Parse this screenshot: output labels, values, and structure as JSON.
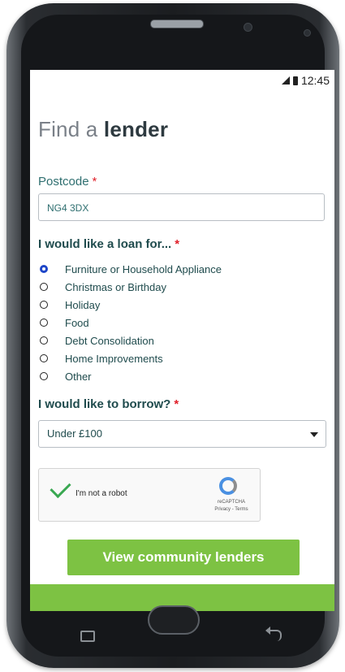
{
  "status": {
    "time": "12:45"
  },
  "form": {
    "title_light": "Find a",
    "title_bold": "lender",
    "postcode_label": "Postcode",
    "postcode_value": "NG4 3DX",
    "required_mark": "*",
    "loan_question": "I would like a loan for...",
    "loan_options": [
      "Furniture or Household Appliance",
      "Christmas or Birthday",
      "Holiday",
      "Food",
      "Debt Consolidation",
      "Home Improvements",
      "Other"
    ],
    "selected_option_index": 0,
    "borrow_question": "I would like to borrow?",
    "borrow_value": "Under £100",
    "captcha_text": "I'm not a robot",
    "captcha_brand": "reCAPTCHA",
    "captcha_links": "Privacy - Terms",
    "submit_label": "View community lenders"
  },
  "colors": {
    "accent_green": "#7dc243",
    "text_teal": "#2f6f70",
    "required_red": "#e0202a",
    "radio_selected": "#1e46c8"
  }
}
